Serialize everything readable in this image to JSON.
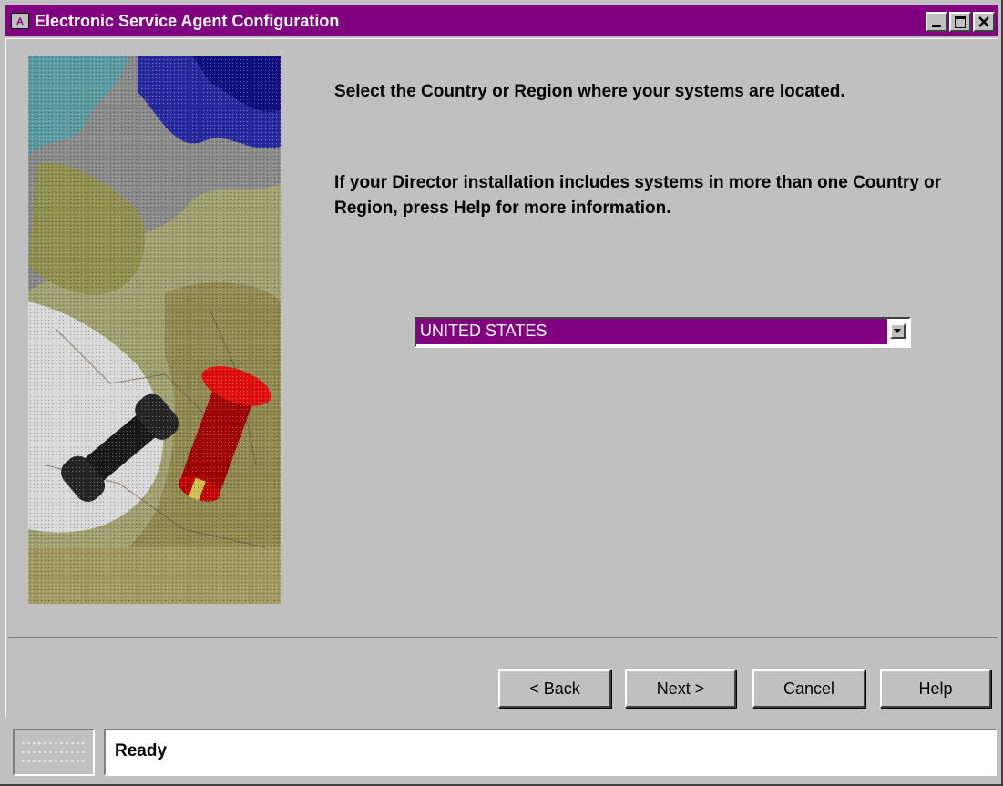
{
  "window": {
    "title": "Electronic Service Agent Configuration"
  },
  "wizard": {
    "instruction_primary": "Select the Country or Region where your systems are located.",
    "instruction_secondary": "If your Director installation includes systems in more than one Country or Region, press Help for more information.",
    "country_select": {
      "selected": "UNITED STATES"
    }
  },
  "buttons": {
    "back": "< Back",
    "next": "Next >",
    "cancel": "Cancel",
    "help": "Help"
  },
  "statusbar": {
    "text": "Ready"
  },
  "colors": {
    "title_bar": "#800080",
    "selection": "#800080",
    "face": "#c0c0c0"
  },
  "icons": {
    "hero": "map-with-pushpin-and-phone",
    "title": "app-window-icon"
  }
}
